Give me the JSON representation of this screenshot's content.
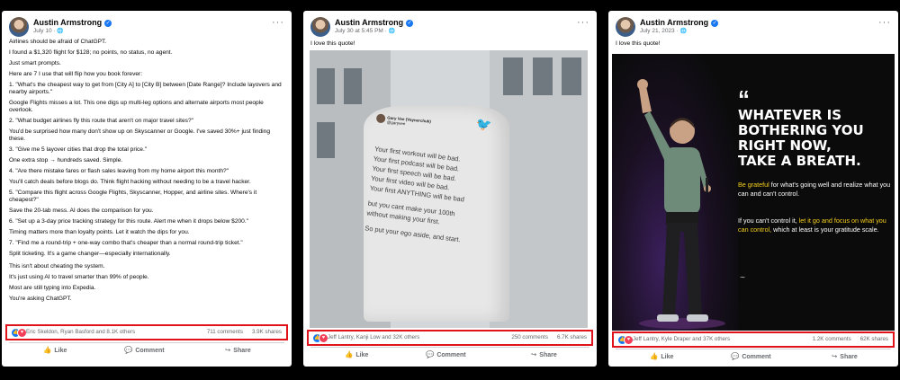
{
  "posts": [
    {
      "author": "Austin Armstrong",
      "date": "July 10",
      "text": [
        "Airlines should be afraid of ChatGPT.",
        "I found a $1,320 flight for $128; no points, no status, no agent.",
        "Just smart prompts.",
        "Here are 7 I use that will flip how you book forever:",
        "1. \"What's the cheapest way to get from [City A] to [City B] between [Date Range]? Include layovers and nearby airports.\"",
        "Google Flights misses a lot. This one digs up multi-leg options and alternate airports most people overlook.",
        "2. \"What budget airlines fly this route that aren't on major travel sites?\"",
        "You'd be surprised how many don't show up on Skyscanner or Google. I've saved 30%+ just finding these.",
        "3. \"Give me 5 layover cities that drop the total price.\"",
        "One extra stop → hundreds saved. Simple.",
        "4. \"Are there mistake fares or flash sales leaving from my home airport this month?\"",
        "You'll catch deals before blogs do. Think flight hacking without needing to be a travel hacker.",
        "5. \"Compare this flight across Google Flights, Skyscanner, Hopper, and airline sites. Where's it cheapest?\"",
        "Save the 20-tab mess. AI does the comparison for you.",
        "6. \"Set up a 3-day price tracking strategy for this route. Alert me when it drops below $200.\"",
        "Timing matters more than loyalty points. Let it watch the dips for you.",
        "7. \"Find me a round-trip + one-way combo that's cheaper than a normal round-trip ticket.\"",
        "Split ticketing. It's a game changer—especially internationally.",
        "This isn't about cheating the system.",
        "It's just using AI to travel smarter than 99% of people.",
        "Most are still typing into Expedia.",
        "You're asking ChatGPT."
      ],
      "reactors": "Eric Skeldon, Ryan Basford and 8.1K others",
      "comments": "711 comments",
      "shares": "3.9K shares"
    },
    {
      "author": "Austin Armstrong",
      "date": "July 30 at 5:45 PM",
      "caption": "I love this quote!",
      "billboard_handle": "Gary Vee (Vaynerchuk)",
      "billboard_sub": "@garyvee",
      "billboard_lines": [
        "Your first workout will be bad.",
        "Your first podcast will be bad.",
        "Your first speech will be bad.",
        "Your first video will be bad.",
        "Your first ANYTHING will be bad",
        "but you cant make your 100th",
        "without making your first.",
        "So put your ego aside, and start."
      ],
      "reactors": "Jeff Lantry, Kanji Low and 32K others",
      "comments": "250 comments",
      "shares": "6.7K shares"
    },
    {
      "author": "Austin Armstrong",
      "date": "July 21, 2023",
      "caption": "I love this quote!",
      "quote_mark": "“",
      "headline": [
        "WHATEVER IS",
        "BOTHERING YOU",
        "RIGHT NOW,",
        "TAKE A BREATH."
      ],
      "p1_highlight": "Be grateful",
      "p1_rest": " for what's going well and realize what you can and can't control.",
      "p2_start": "If you can't control it, ",
      "p2_highlight": "let it go and focus on what you can control,",
      "p2_rest": " which at least is your gratitude scale.",
      "signature": "~",
      "reactors": "Jeff Lantry, Kyle Draper and 37K others",
      "comments": "1.2K comments",
      "shares": "62K shares"
    }
  ],
  "actions": {
    "like": "Like",
    "comment": "Comment",
    "share": "Share"
  },
  "icons": {
    "like": "thumbs-up-icon",
    "comment": "comment-bubble-icon",
    "share": "share-arrow-icon",
    "more": "more-dots-icon",
    "verified": "verified-badge-icon",
    "globe": "globe-icon"
  },
  "colors": {
    "highlight_box": "#e0131a",
    "fb_blue": "#1877f2",
    "love_red": "#f33e58",
    "quote_yellow": "#f7d11d"
  }
}
